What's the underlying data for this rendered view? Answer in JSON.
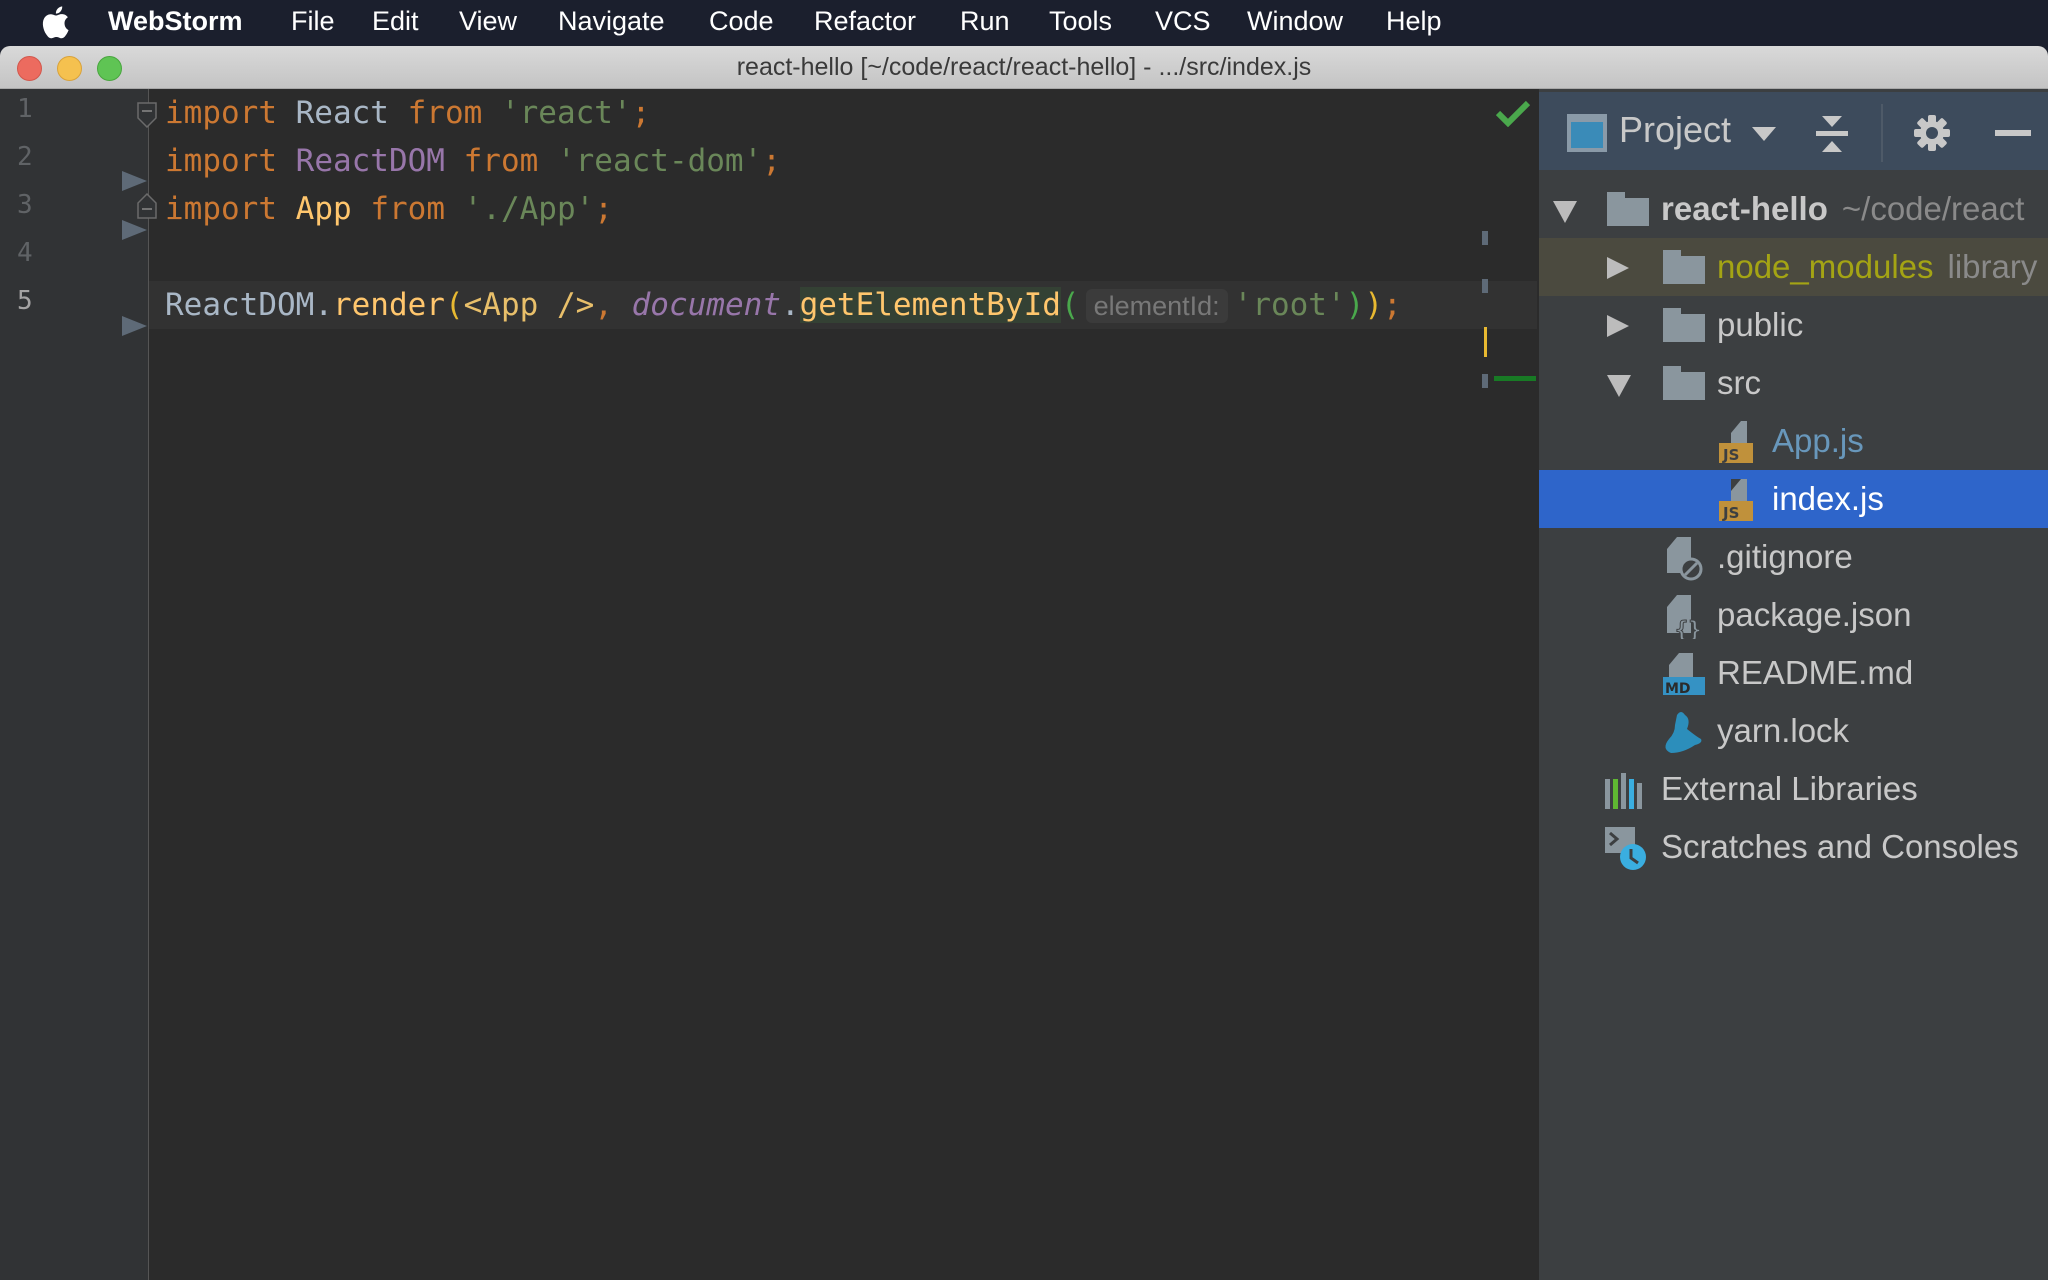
{
  "menubar": {
    "app_name": "WebStorm",
    "items": [
      "File",
      "Edit",
      "View",
      "Navigate",
      "Code",
      "Refactor",
      "Run",
      "Tools",
      "VCS",
      "Window",
      "Help"
    ],
    "status_icons": [
      "battery-charging-icon",
      "battery-level-icon",
      "wifi-icon",
      "clock-icon",
      "control-center-icon",
      "box-icon",
      "more-icon",
      "list-icon"
    ]
  },
  "window": {
    "title": "react-hello [~/code/react/react-hello] - .../src/index.js"
  },
  "editor": {
    "line_numbers": [
      "1",
      "2",
      "3",
      "4",
      "5"
    ],
    "current_line": 5,
    "lines": [
      [
        {
          "t": "import",
          "c": "kw"
        },
        {
          "t": " React ",
          "c": "ident"
        },
        {
          "t": "from",
          "c": "kw"
        },
        {
          "t": " 'react'",
          "c": "str"
        },
        {
          "t": ";",
          "c": "kw"
        }
      ],
      [
        {
          "t": "import",
          "c": "kw"
        },
        {
          "t": " ",
          "c": "ident"
        },
        {
          "t": "ReactDOM",
          "c": "cls"
        },
        {
          "t": " ",
          "c": "ident"
        },
        {
          "t": "from",
          "c": "kw"
        },
        {
          "t": " 'react-dom'",
          "c": "str"
        },
        {
          "t": ";",
          "c": "kw"
        }
      ],
      [
        {
          "t": "import",
          "c": "kw"
        },
        {
          "t": " ",
          "c": "ident"
        },
        {
          "t": "App",
          "c": "fn"
        },
        {
          "t": " ",
          "c": "ident"
        },
        {
          "t": "from",
          "c": "kw"
        },
        {
          "t": " './App'",
          "c": "str"
        },
        {
          "t": ";",
          "c": "kw"
        }
      ],
      [],
      [
        {
          "t": "ReactDOM",
          "c": "ident"
        },
        {
          "t": ".",
          "c": "dot"
        },
        {
          "t": "render",
          "c": "fn"
        },
        {
          "t": "(",
          "c": "paren-y"
        },
        {
          "t": "<App />",
          "c": "tag"
        },
        {
          "t": ", ",
          "c": "kw"
        },
        {
          "t": "document",
          "c": "doc"
        },
        {
          "t": ".",
          "c": "dot"
        },
        {
          "t": "getElementById",
          "c": "fnhl"
        },
        {
          "t": "(",
          "c": "paren-g"
        },
        {
          "t": "elementId:",
          "c": "hint"
        },
        {
          "t": "'root'",
          "c": "str"
        },
        {
          "t": ")",
          "c": "paren-g"
        },
        {
          "t": ")",
          "c": "paren-y"
        },
        {
          "t": ";",
          "c": "kw"
        }
      ]
    ],
    "inspection_status": "no-problems"
  },
  "project_panel": {
    "title": "Project",
    "tree": [
      {
        "label": "react-hello",
        "sub": "~/code/react",
        "type": "folder",
        "depth": 0,
        "expanded": true,
        "bold": true
      },
      {
        "label": "node_modules",
        "sub": "library root",
        "type": "folder",
        "depth": 1,
        "expanded": false,
        "color": "#a4a414",
        "lib": true
      },
      {
        "label": "public",
        "type": "folder",
        "depth": 1,
        "expanded": false
      },
      {
        "label": "src",
        "type": "folder",
        "depth": 1,
        "expanded": true
      },
      {
        "label": "App.js",
        "type": "js",
        "depth": 2,
        "color": "#6897bb"
      },
      {
        "label": "index.js",
        "type": "js",
        "depth": 2,
        "selected": true
      },
      {
        "label": ".gitignore",
        "type": "gitignore",
        "depth": 1
      },
      {
        "label": "package.json",
        "type": "json",
        "depth": 1
      },
      {
        "label": "README.md",
        "type": "md",
        "depth": 1
      },
      {
        "label": "yarn.lock",
        "type": "yarn",
        "depth": 1
      },
      {
        "label": "External Libraries",
        "type": "libraries",
        "depth": 0
      },
      {
        "label": "Scratches and Consoles",
        "type": "scratches",
        "depth": 0
      }
    ]
  },
  "colors": {
    "selection": "#2e65ca",
    "keyword": "#cc7832",
    "string": "#6a8759",
    "function": "#ffc66d",
    "class": "#9876aa"
  }
}
